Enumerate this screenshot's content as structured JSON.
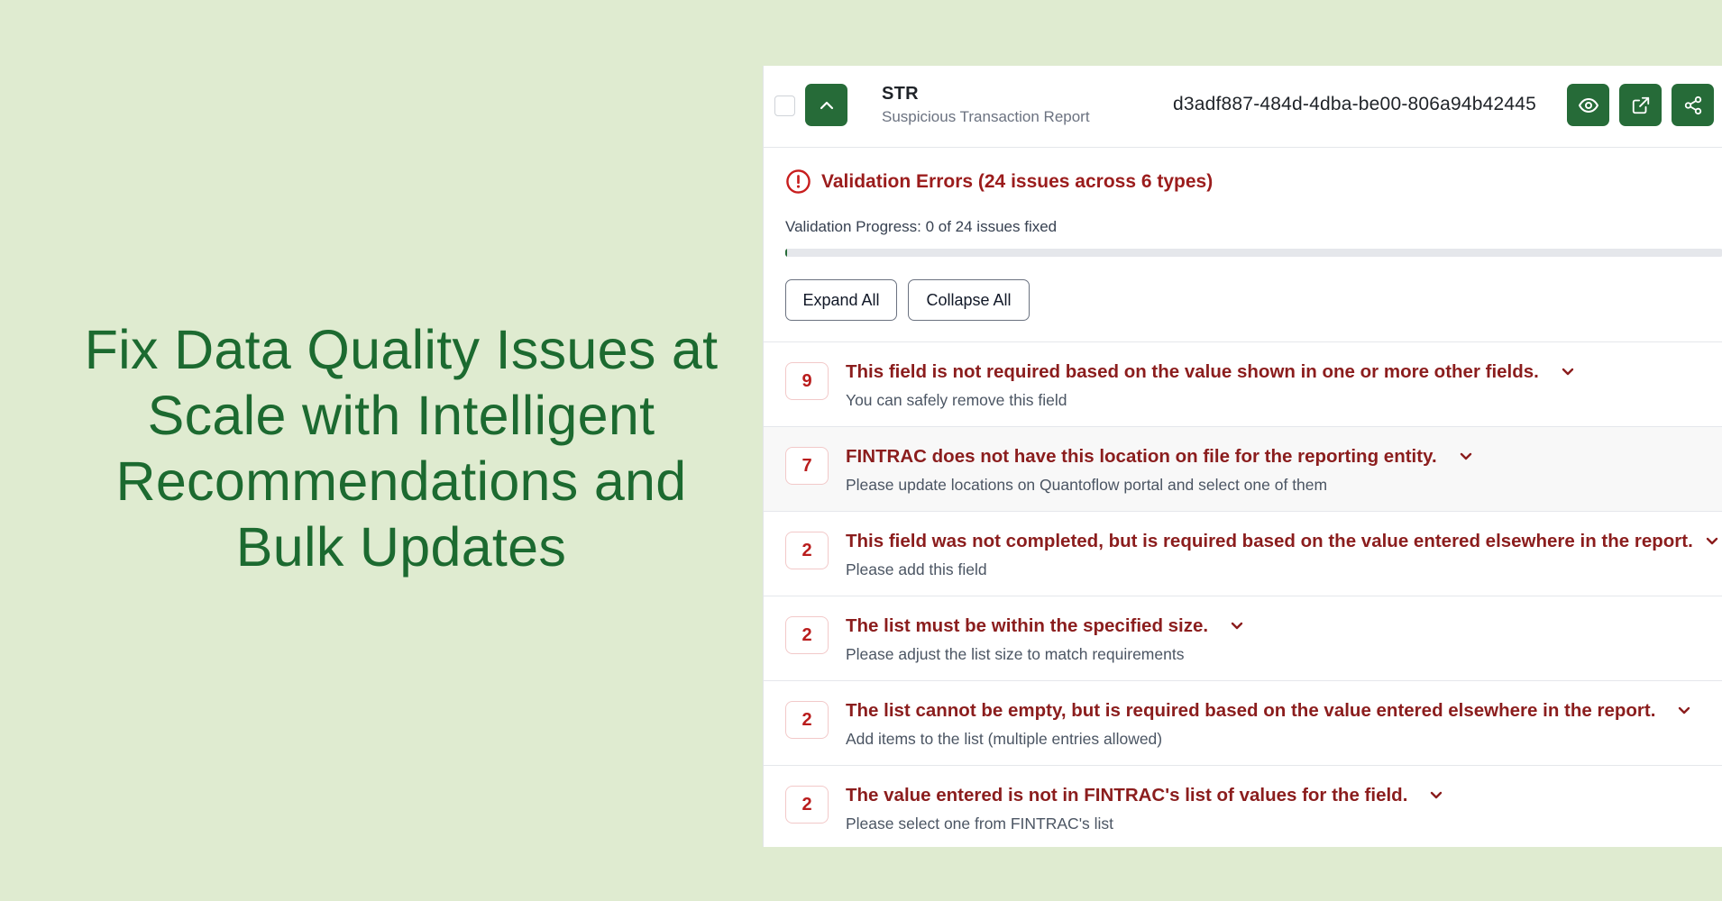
{
  "headline": "Fix Data Quality Issues at Scale with Intelligent Recommendations and Bulk Updates",
  "report": {
    "type": "STR",
    "description": "Suspicious Transaction Report",
    "id": "d3adf887-484d-4dba-be00-806a94b42445"
  },
  "icons": {
    "collapse": "chevron-up-icon",
    "view": "eye-icon",
    "open": "external-link-icon",
    "share": "share-icon",
    "error": "alert-circle-icon",
    "expand_issue": "chevron-down-icon"
  },
  "validation": {
    "title": "Validation Errors (24 issues across 6 types)",
    "progress_text": "Validation Progress: 0 of 24 issues fixed",
    "progress_fraction": 0
  },
  "buttons": {
    "expand_all": "Expand All",
    "collapse_all": "Collapse All"
  },
  "issues": [
    {
      "count": "9",
      "title": "This field is not required based on the value shown in one or more other fields.",
      "hint": "You can safely remove this field"
    },
    {
      "count": "7",
      "title": "FINTRAC does not have this location on file for the reporting entity.",
      "hint": "Please update locations on Quantoflow portal and select one of them"
    },
    {
      "count": "2",
      "title": "This field was not completed, but is required based on the value entered elsewhere in the report.",
      "hint": "Please add this field"
    },
    {
      "count": "2",
      "title": "The list must be within the specified size.",
      "hint": "Please adjust the list size to match requirements"
    },
    {
      "count": "2",
      "title": "The list cannot be empty, but is required based on the value entered elsewhere in the report.",
      "hint": "Add items to the list (multiple entries allowed)"
    },
    {
      "count": "2",
      "title": "The value entered is not in FINTRAC's list of values for the field.",
      "hint": "Please select one from FINTRAC's list"
    }
  ],
  "colors": {
    "background": "#dfebd0",
    "brand_green": "#266b38",
    "headline_green": "#1c6a30",
    "error_red": "#9b1c1c"
  }
}
